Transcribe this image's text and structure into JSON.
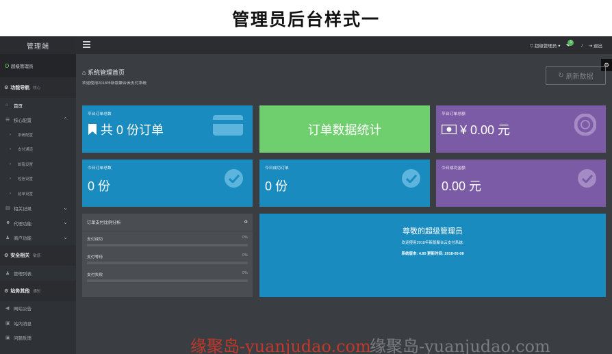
{
  "banner": {
    "title": "管理员后台样式一"
  },
  "sidebar": {
    "brand": "管理端",
    "user": "超级管理员",
    "sections": {
      "functions": {
        "label": "功能导航",
        "hint": "核心"
      },
      "security": {
        "label": "安全相关",
        "hint": "敏感"
      },
      "other": {
        "label": "站务其他",
        "hint": "通知"
      }
    },
    "items": {
      "home": "首页",
      "core_config": "核心配置",
      "system_config": "系统配置",
      "pay_channel": "支付通道",
      "email_config": "邮箱设置",
      "sms_config": "短信设置",
      "settle_config": "结单设置",
      "records": "相关记录",
      "agent": "代理功能",
      "merchant": "商户功能",
      "admin_list": "管理列表",
      "announce": "网站公告",
      "messages": "站内消息",
      "feedback": "问题反馈"
    }
  },
  "topbar": {
    "admin": "超级管理员",
    "badge": "1",
    "logout": "退出"
  },
  "header": {
    "title": "系统管理首页",
    "subtitle": "欢迎使用2018年新版聚合云支付系统",
    "refresh": "刷新数据"
  },
  "cards": {
    "platform_orders": {
      "label": "平台订单总数",
      "value": "共 0 份订单"
    },
    "stats": {
      "value": "订单数据统计"
    },
    "platform_amount": {
      "label": "平台订单总额",
      "value": "¥ 0.00 元"
    },
    "today_orders": {
      "label": "今日订单总数",
      "value": "0 份"
    },
    "today_success": {
      "label": "今日成功订单",
      "value": "0 份"
    },
    "today_amount": {
      "label": "今日成功金额",
      "value": "0.00 元"
    }
  },
  "analysis": {
    "title": "订单支付比例分析",
    "rows": [
      {
        "name": "支付成功",
        "pct": "0%"
      },
      {
        "name": "支付等待",
        "pct": "0%"
      },
      {
        "name": "支付失败",
        "pct": "0%"
      }
    ]
  },
  "welcome": {
    "title": "尊敬的超级管理员",
    "line1": "欢迎使用2018年新版聚合云支付系统:",
    "line2": "系统版本: 4.85 更新时间: 2018-05-08"
  },
  "watermark": {
    "primary": "缘聚岛-yuanjudao.com",
    "secondary": "缘聚岛-yuanjudao.com"
  },
  "colors": {
    "blue": "#1a8bbe",
    "green": "#6fcf6f",
    "purple": "#7b5aa6",
    "sidebar": "#2e3136"
  }
}
